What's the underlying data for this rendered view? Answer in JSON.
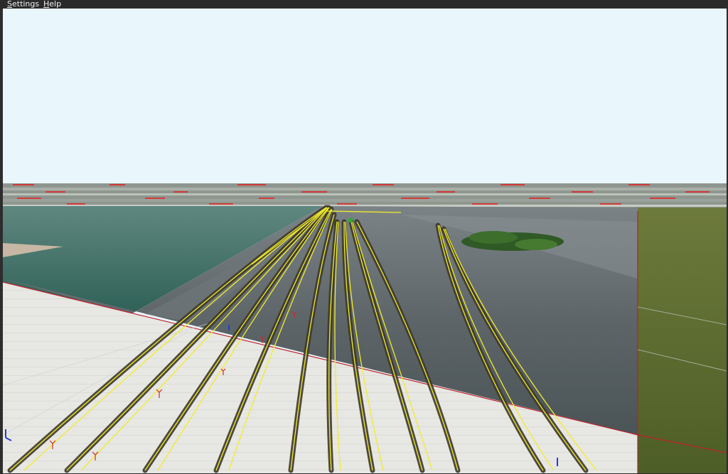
{
  "menubar": {
    "items": [
      {
        "label": "Settings",
        "mnemonic": "S",
        "rest": "ettings"
      },
      {
        "label": "Help",
        "mnemonic": "H",
        "rest": "elp"
      }
    ]
  },
  "viewport": {
    "colors": {
      "sky": "#e9f6fb",
      "track_line": "#f2ec2a",
      "track_bed": "#4a4638",
      "grid_boundary": "#c0202a",
      "water": "#3f6d63",
      "grass": "#5d6b2e",
      "unloaded_tile": "#e6e6e3"
    },
    "icons": [
      "signal-marker-icon",
      "axis-gizmo-icon",
      "tree-cluster-icon"
    ]
  }
}
